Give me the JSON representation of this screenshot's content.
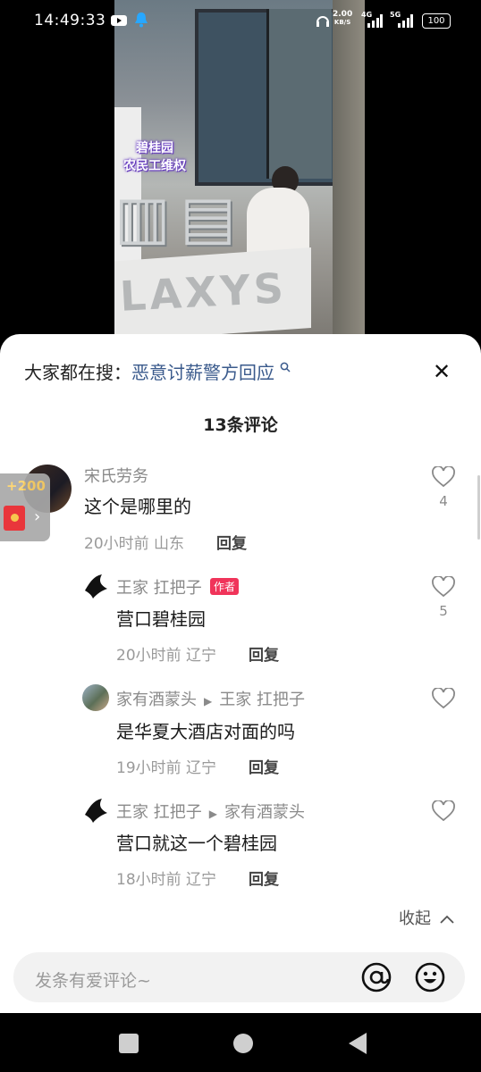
{
  "status_bar": {
    "time": "14:49:33",
    "speed_value": "2.00",
    "speed_unit": "KB/S",
    "net1": "4G",
    "net2": "5G",
    "battery": "100"
  },
  "video": {
    "caption_line1": "碧桂园",
    "caption_line2": "农民工维权",
    "sign_text": "LAXYS"
  },
  "search": {
    "prefix": "大家都在搜：",
    "keyword": "恶意讨薪警方回应"
  },
  "comments_header": "13条评论",
  "comments": [
    {
      "user": "宋氏劳务",
      "text": "这个是哪里的",
      "time": "20小时前",
      "location": "山东",
      "reply_label": "回复",
      "likes": "4"
    },
    {
      "user": "王家 扛把子",
      "badge": "作者",
      "text": "营口碧桂园",
      "time": "20小时前",
      "location": "辽宁",
      "reply_label": "回复",
      "likes": "5"
    },
    {
      "user": "家有酒蒙头",
      "reply_to": "王家 扛把子",
      "text": "是华夏大酒店对面的吗",
      "time": "19小时前",
      "location": "辽宁",
      "reply_label": "回复"
    },
    {
      "user": "王家 扛把子",
      "reply_to": "家有酒蒙头",
      "text": "营口就这一个碧桂园",
      "time": "18小时前",
      "location": "辽宁",
      "reply_label": "回复"
    }
  ],
  "collapse_label": "收起",
  "red_packet": {
    "amount": "+200"
  },
  "input": {
    "placeholder": "发条有爱评论~"
  },
  "colors": {
    "badge": "#f0345a",
    "keyword": "#3a5a8c"
  }
}
